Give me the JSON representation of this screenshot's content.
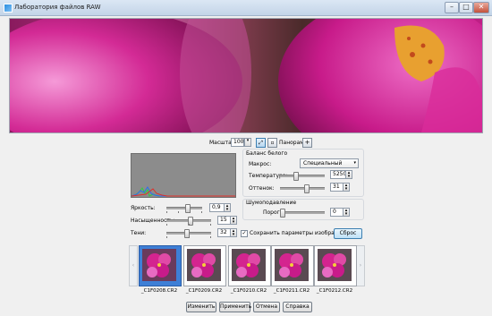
{
  "window": {
    "title": "Лаборатория файлов RAW",
    "controls": {
      "minimize": "–",
      "maximize": "□",
      "close": "✕"
    }
  },
  "zoom": {
    "label": "Масштаб:",
    "value": "100",
    "fit_label": "▭",
    "panorama_label": "Панорама:",
    "panorama_button": "+"
  },
  "adjust": {
    "brightness_label": "Яркость:",
    "brightness_value": "0,9",
    "brightness_level": 0.62,
    "saturation_label": "Насыщенность:",
    "saturation_value": "15",
    "saturation_level": 0.55,
    "shadows_label": "Тени:",
    "shadows_value": "32",
    "shadows_level": 0.45
  },
  "white_balance": {
    "title": "Баланс белого",
    "preset_label": "Макрос:",
    "preset_value": "Специальный",
    "temperature_label": "Температура:",
    "temperature_value": "5250",
    "temperature_level": 0.35,
    "tint_label": "Оттенок:",
    "tint_value": "31",
    "tint_level": 0.62
  },
  "noise": {
    "title": "Шумоподавление",
    "threshold_label": "Порог:",
    "threshold_value": "0",
    "threshold_level": 0.0
  },
  "options": {
    "save_params_label": "Сохранить параметры изображения",
    "save_params_checked": "✓",
    "reset_label": "Сброс"
  },
  "filmstrip": {
    "prev": "‹",
    "next": "›",
    "items": [
      {
        "name": "_C1F0208.CR2",
        "selected": true
      },
      {
        "name": "_C1F0209.CR2",
        "selected": false
      },
      {
        "name": "_C1F0210.CR2",
        "selected": false
      },
      {
        "name": "_C1F0211.CR2",
        "selected": false
      },
      {
        "name": "_C1F0212.CR2",
        "selected": false
      }
    ]
  },
  "footer": {
    "change_label": "Изменить",
    "apply_label": "Применить",
    "cancel_label": "Отмена",
    "help_label": "Справка"
  },
  "colors": {
    "accent": "#3e7fd6",
    "orchid": "#d4248f",
    "orchid_light": "#f07bd0",
    "background": "#f0f0f0"
  },
  "icons": {
    "fit": "fit-to-window-icon",
    "panorama_toggle": "panorama-icon"
  }
}
